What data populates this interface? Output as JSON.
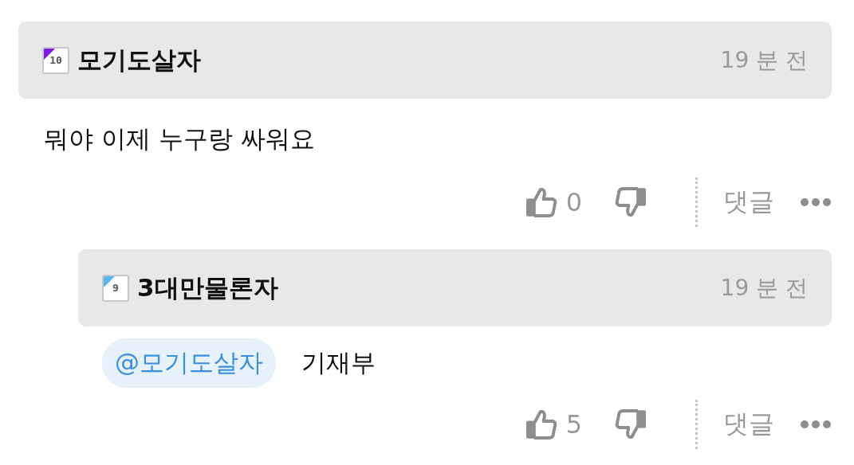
{
  "comments": [
    {
      "level": "10",
      "color": "#7b1fe6",
      "author": "모기도살자",
      "time": "19 분 전",
      "text": "뭐야 이제 누구랑 싸워요",
      "likes": "0",
      "reply_label": "댓글",
      "children": [
        {
          "level": "9",
          "color": "#5ab4ee",
          "author": "3대만물론자",
          "time": "19 분 전",
          "mention": "@모기도살자",
          "text": "기재부",
          "likes": "5",
          "reply_label": "댓글"
        }
      ]
    }
  ]
}
